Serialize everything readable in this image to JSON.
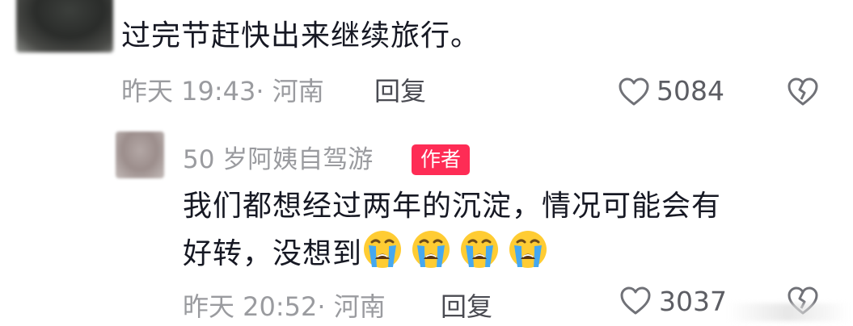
{
  "comment_1": {
    "text": "过完节赶快出来继续旅行。",
    "timestamp": "昨天 19:43",
    "separator": "·",
    "location": "河南",
    "reply_label": "回复",
    "like_count": "5084"
  },
  "comment_2": {
    "author": "50 岁阿姨自驾游",
    "badge": "作者",
    "text_line1": "我们都想经过两年的沉淀，情况可能会有",
    "text_line2": "好转，没想到",
    "emojis": [
      "loudly-crying-face",
      "loudly-crying-face",
      "loudly-crying-face",
      "loudly-crying-face"
    ],
    "timestamp": "昨天 20:52",
    "separator": "·",
    "location": "河南",
    "reply_label": "回复",
    "like_count": "3037"
  },
  "colors": {
    "badge_bg": "#fe2c55",
    "meta_text": "#9a9b9f",
    "body_text": "#161823"
  }
}
